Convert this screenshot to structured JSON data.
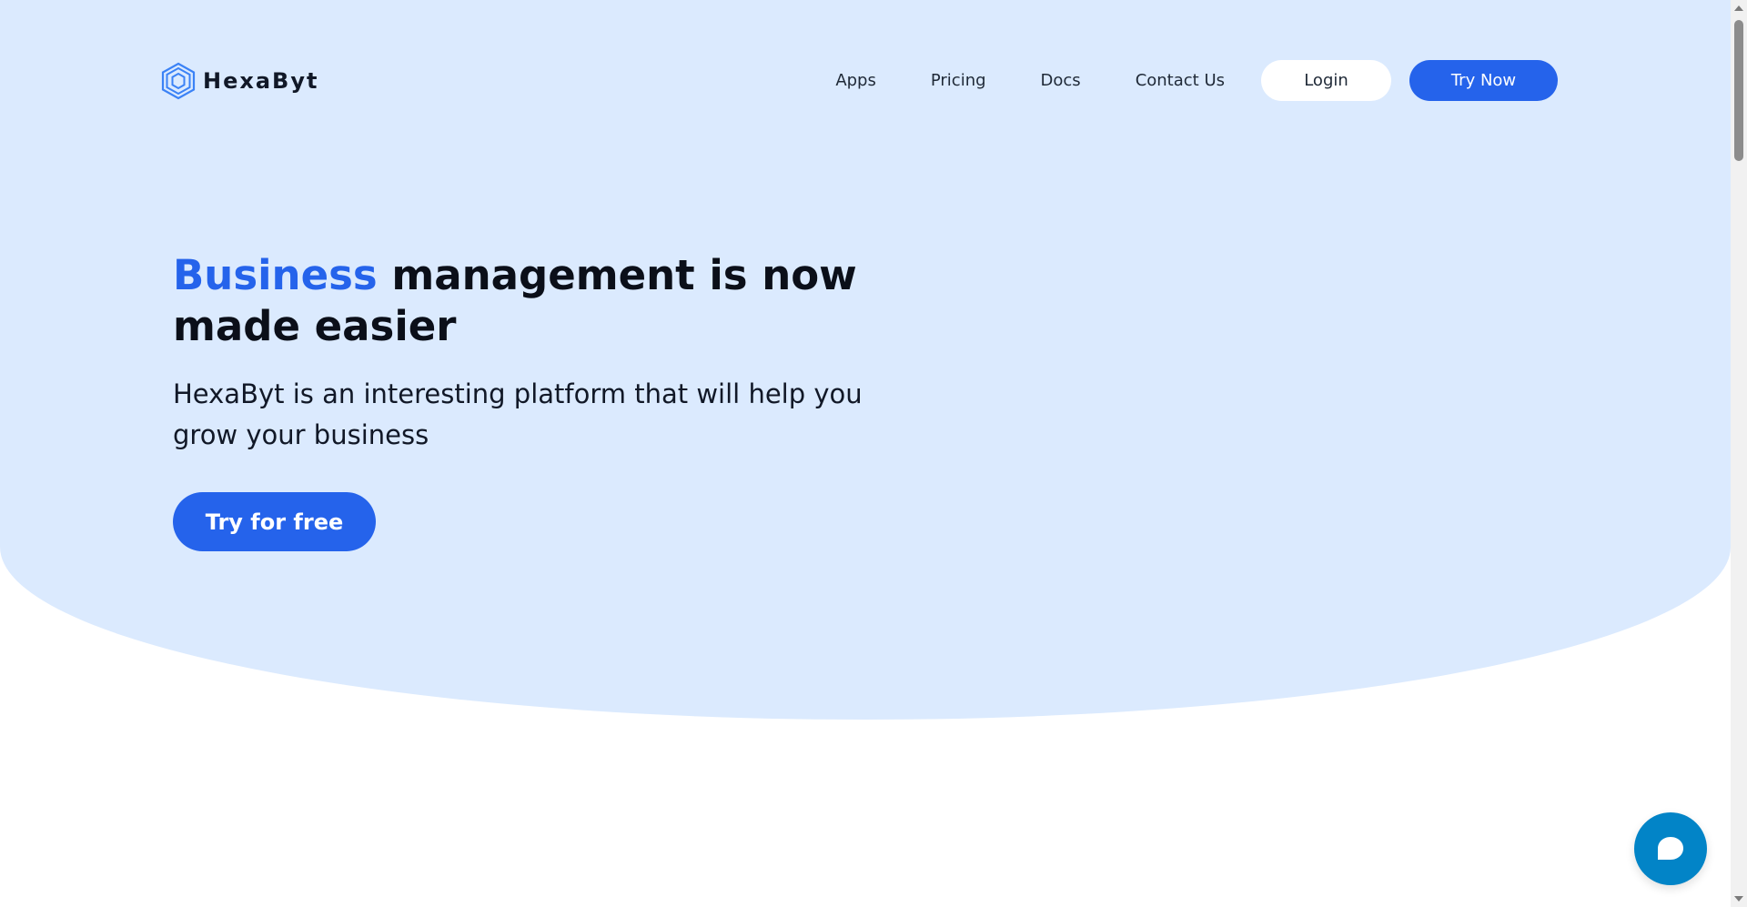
{
  "brand": {
    "name": "HexaByt",
    "logo_icon": "hexagon-logo-icon",
    "accent_color": "#2563eb",
    "hero_bg_color": "#dbeafe"
  },
  "nav": {
    "links": [
      {
        "label": "Apps"
      },
      {
        "label": "Pricing"
      },
      {
        "label": "Docs"
      },
      {
        "label": "Contact Us"
      }
    ],
    "login_label": "Login",
    "try_now_label": "Try Now"
  },
  "hero": {
    "title_accent": "Business",
    "title_rest": " management is now made easier",
    "subtitle": "HexaByt is an interesting platform that will help you grow your business",
    "cta_label": "Try for free"
  },
  "chat": {
    "icon": "chat-bubble-icon",
    "color": "#0284c7"
  }
}
